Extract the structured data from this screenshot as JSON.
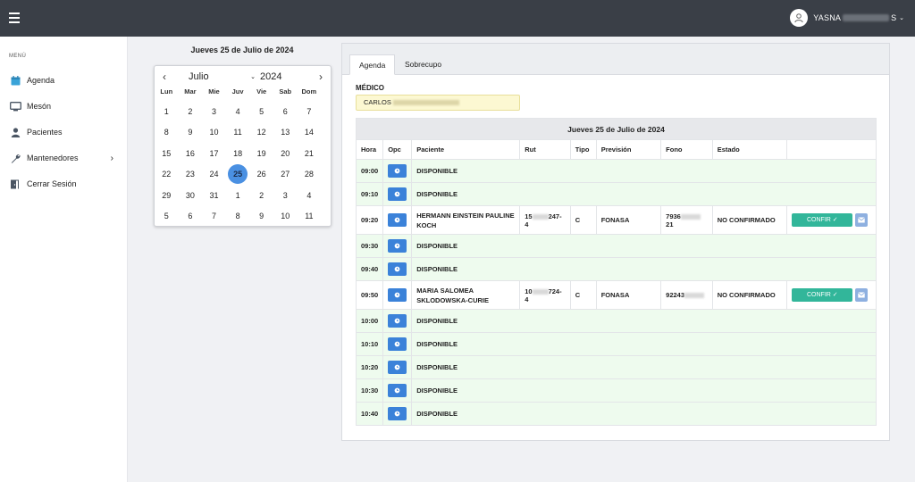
{
  "topbar": {
    "user_name_start": "YASNA",
    "user_name_end": "S"
  },
  "sidebar": {
    "menu_title": "MENÚ",
    "items": [
      {
        "label": "Agenda"
      },
      {
        "label": "Mesón"
      },
      {
        "label": "Pacientes"
      },
      {
        "label": "Mantenedores"
      },
      {
        "label": "Cerrar Sesión"
      }
    ]
  },
  "calendar": {
    "date_title": "Jueves 25 de Julio de 2024",
    "month": "Julio",
    "year": "2024",
    "days_of_week": [
      "Lun",
      "Mar",
      "Mie",
      "Juv",
      "Vie",
      "Sab",
      "Dom"
    ],
    "weeks": [
      [
        "1",
        "2",
        "3",
        "4",
        "5",
        "6",
        "7"
      ],
      [
        "8",
        "9",
        "10",
        "11",
        "12",
        "13",
        "14"
      ],
      [
        "15",
        "16",
        "17",
        "18",
        "19",
        "20",
        "21"
      ],
      [
        "22",
        "23",
        "24",
        "25",
        "26",
        "27",
        "28"
      ],
      [
        "29",
        "30",
        "31",
        "1",
        "2",
        "3",
        "4"
      ],
      [
        "5",
        "6",
        "7",
        "8",
        "9",
        "10",
        "11"
      ]
    ],
    "selected_day": "25"
  },
  "tabs": {
    "agenda": "Agenda",
    "sobrecupo": "Sobrecupo"
  },
  "medico": {
    "label": "MÉDICO",
    "value_prefix": "CARLOS"
  },
  "table": {
    "title": "Jueves 25 de Julio de 2024",
    "headers": [
      "Hora",
      "Opc",
      "Paciente",
      "Rut",
      "Tipo",
      "Previsión",
      "Fono",
      "Estado",
      ""
    ],
    "rows": [
      {
        "hora": "09:00",
        "paciente": "DISPONIBLE"
      },
      {
        "hora": "09:10",
        "paciente": "DISPONIBLE"
      },
      {
        "hora": "09:20",
        "paciente_l1": "HERMANN EINSTEIN PAULINE",
        "paciente_l2": "KOCH",
        "rut_a": "15",
        "rut_b": "247-4",
        "tipo": "C",
        "prevision": "FONASA",
        "fono_a": "7936",
        "fono_b": "21",
        "estado": "NO CONFIRMADO",
        "action": "CONFIR ✓"
      },
      {
        "hora": "09:30",
        "paciente": "DISPONIBLE"
      },
      {
        "hora": "09:40",
        "paciente": "DISPONIBLE"
      },
      {
        "hora": "09:50",
        "paciente_l1": "MARIA SALOMEA",
        "paciente_l2": "SKLODOWSKA-CURIE",
        "rut_a": "10",
        "rut_b": "724-4",
        "tipo": "C",
        "prevision": "FONASA",
        "fono_a": "92243",
        "fono_b": "",
        "estado": "NO CONFIRMADO",
        "action": "CONFIR ✓"
      },
      {
        "hora": "10:00",
        "paciente": "DISPONIBLE"
      },
      {
        "hora": "10:10",
        "paciente": "DISPONIBLE"
      },
      {
        "hora": "10:20",
        "paciente": "DISPONIBLE"
      },
      {
        "hora": "10:30",
        "paciente": "DISPONIBLE"
      },
      {
        "hora": "10:40",
        "paciente": "DISPONIBLE"
      }
    ]
  },
  "colors": {
    "topbar": "#3a3f47",
    "accent": "#4a90e2",
    "confirm": "#32b69a",
    "free_row": "#eefbee"
  }
}
